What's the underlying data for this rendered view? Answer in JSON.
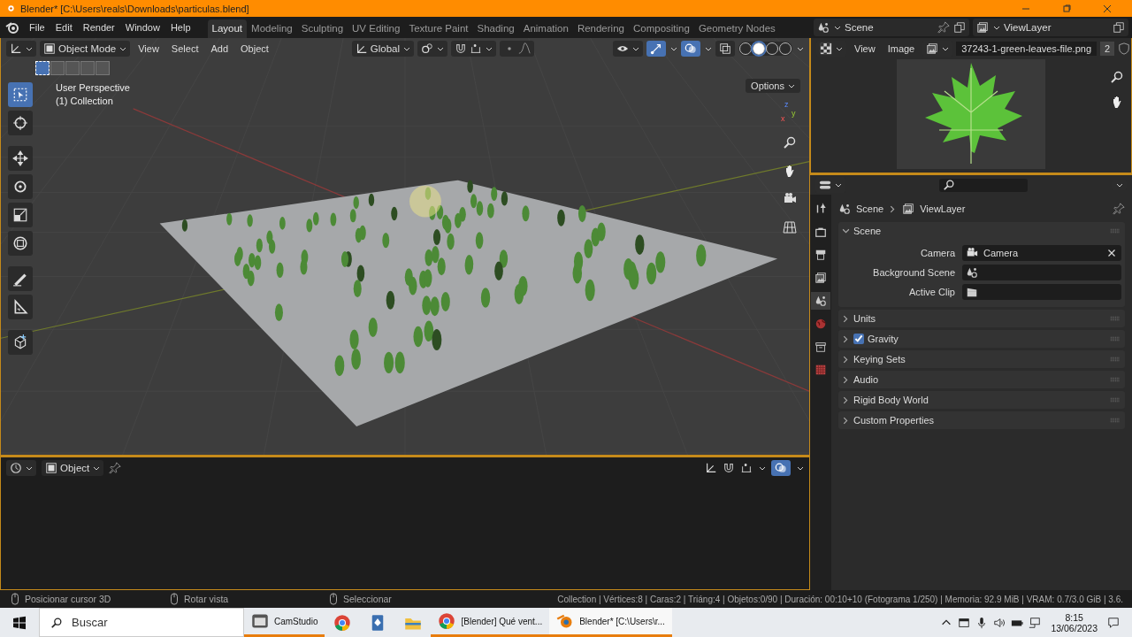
{
  "window": {
    "title": "Blender* [C:\\Users\\reals\\Downloads\\particulas.blend]"
  },
  "menu": [
    "File",
    "Edit",
    "Render",
    "Window",
    "Help"
  ],
  "workspaces": [
    {
      "label": "Layout",
      "selected": true
    },
    {
      "label": "Modeling",
      "selected": false
    },
    {
      "label": "Sculpting",
      "selected": false
    },
    {
      "label": "UV Editing",
      "selected": false
    },
    {
      "label": "Texture Paint",
      "selected": false
    },
    {
      "label": "Shading",
      "selected": false
    },
    {
      "label": "Animation",
      "selected": false
    },
    {
      "label": "Rendering",
      "selected": false
    },
    {
      "label": "Compositing",
      "selected": false
    },
    {
      "label": "Geometry Nodes",
      "selected": false
    }
  ],
  "scene_selector": {
    "value": "Scene"
  },
  "view_layer_selector": {
    "value": "ViewLayer"
  },
  "viewport": {
    "mode": "Object Mode",
    "menus": [
      "View",
      "Select",
      "Add",
      "Object"
    ],
    "orientation": "Global",
    "options": "Options",
    "overlay_lines": [
      "User Perspective",
      "(1) Collection"
    ],
    "gizmo_axes": [
      "z",
      "y",
      "x"
    ],
    "select_modes": [
      {
        "selected": true
      },
      {
        "selected": false
      },
      {
        "selected": false
      },
      {
        "selected": false
      },
      {
        "selected": false
      }
    ],
    "tools": [
      {
        "kind": "select",
        "selected": true
      },
      {
        "kind": "cursor",
        "selected": false
      },
      {
        "kind": "move",
        "selected": false
      },
      {
        "kind": "rotate",
        "selected": false
      },
      {
        "kind": "scale",
        "selected": false
      },
      {
        "kind": "transform",
        "selected": false
      },
      {
        "kind": "annotate",
        "selected": false
      },
      {
        "kind": "measure",
        "selected": false
      },
      {
        "kind": "add-cube",
        "selected": false
      }
    ],
    "shading": [
      {
        "selected": false
      },
      {
        "selected": true
      },
      {
        "selected": false
      },
      {
        "selected": false
      }
    ]
  },
  "image_editor": {
    "menus": [
      "View",
      "Image"
    ],
    "image_name": "37243-1-green-leaves-file.png",
    "users": "2"
  },
  "timeline": {
    "mode": "Object"
  },
  "properties": {
    "breadcrumb": [
      "Scene",
      "ViewLayer"
    ],
    "tabs": [
      {
        "kind": "tool",
        "selected": false
      },
      {
        "kind": "render",
        "selected": false
      },
      {
        "kind": "output",
        "selected": false
      },
      {
        "kind": "view-layer",
        "selected": false
      },
      {
        "kind": "scene",
        "selected": true
      },
      {
        "kind": "world",
        "selected": false
      },
      {
        "kind": "collection",
        "selected": false
      },
      {
        "kind": "texture",
        "selected": false
      }
    ],
    "panels": [
      {
        "title": "Scene",
        "expanded": true,
        "kind": "plain",
        "fields": [
          {
            "label": "Camera",
            "value": "Camera",
            "kind": "camera"
          },
          {
            "label": "Background Scene",
            "kind": "scene"
          },
          {
            "label": "Active Clip",
            "kind": "clip"
          }
        ]
      },
      {
        "title": "Units",
        "expanded": false,
        "kind": "plain"
      },
      {
        "title": "Gravity",
        "expanded": false,
        "kind": "checkbox",
        "checked": true
      },
      {
        "title": "Keying Sets",
        "expanded": false,
        "kind": "plain"
      },
      {
        "title": "Audio",
        "expanded": false,
        "kind": "plain"
      },
      {
        "title": "Rigid Body World",
        "expanded": false,
        "kind": "plain"
      },
      {
        "title": "Custom Properties",
        "expanded": false,
        "kind": "plain"
      }
    ]
  },
  "status_bar": {
    "hints": [
      "Posicionar cursor 3D",
      "Rotar vista",
      "Seleccionar"
    ],
    "stats": "Collection | Vértices:8 | Caras:2 | Triáng:4 | Objetos:0/90 | Duración: 00:10+10 (Fotograma 1/250) | Memoria: 92.9 MiB | VRAM: 0.7/3.0 GiB | 3.6."
  },
  "taskbar": {
    "search": {
      "placeholder": "Buscar"
    },
    "apps": [
      {
        "kind": "camstudio",
        "label": "CamStudio",
        "running": true,
        "selected": false
      },
      {
        "kind": "chrome",
        "running": false,
        "selected": false
      },
      {
        "kind": "cards",
        "running": false,
        "selected": false
      },
      {
        "kind": "folder",
        "running": false,
        "selected": false
      },
      {
        "kind": "chrome",
        "label": "[Blender] Qué vent...",
        "running": true,
        "selected": false
      },
      {
        "kind": "blender",
        "label": "Blender* [C:\\Users\\r...",
        "running": true,
        "selected": true
      }
    ],
    "time": "8:15",
    "date": "13/06/2023"
  }
}
